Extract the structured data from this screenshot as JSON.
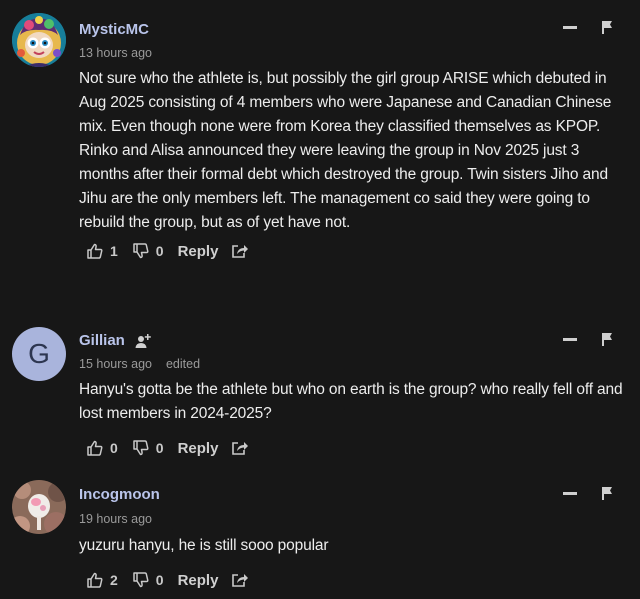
{
  "comments": [
    {
      "username": "MysticMC",
      "time": "13 hours ago",
      "edited": "",
      "text": "Not sure who the athlete is, but possibly the girl group ARISE which debuted in Aug 2025 consisting of 4 members who were Japanese and Canadian Chinese mix. Even though none were from Korea they classified themselves as KPOP. Rinko and Alisa announced they were leaving the group in Nov 2025 just 3 months after their formal debt which destroyed the group. Twin sisters Jiho and Jihu are the only members left. The management co said they were going to rebuild the group, but as of yet have not.",
      "likes": "1",
      "dislikes": "0",
      "reply_label": "Reply",
      "avatar": "illustrated-avatar"
    },
    {
      "username": "Gillian",
      "time": "15 hours ago",
      "edited": "edited",
      "text": "Hanyu's gotta be the athlete but who on earth is the group? who really fell off and lost members in 2024-2025?",
      "likes": "0",
      "dislikes": "0",
      "reply_label": "Reply",
      "avatar_letter": "G"
    },
    {
      "username": "Incogmoon",
      "time": "19 hours ago",
      "edited": "",
      "text": "yuzuru hanyu, he is still sooo popular",
      "likes": "2",
      "dislikes": "0",
      "reply_label": "Reply",
      "avatar": "photo-avatar"
    }
  ],
  "colors": {
    "background": "#171717",
    "username": "#b9c4ea",
    "meta": "#9a9a9a",
    "letter_avatar_bg": "#a9b4dc"
  },
  "icons": [
    "thumbs-up-icon",
    "thumbs-down-icon",
    "share-icon",
    "collapse-icon",
    "flag-icon",
    "follow-user-icon"
  ]
}
